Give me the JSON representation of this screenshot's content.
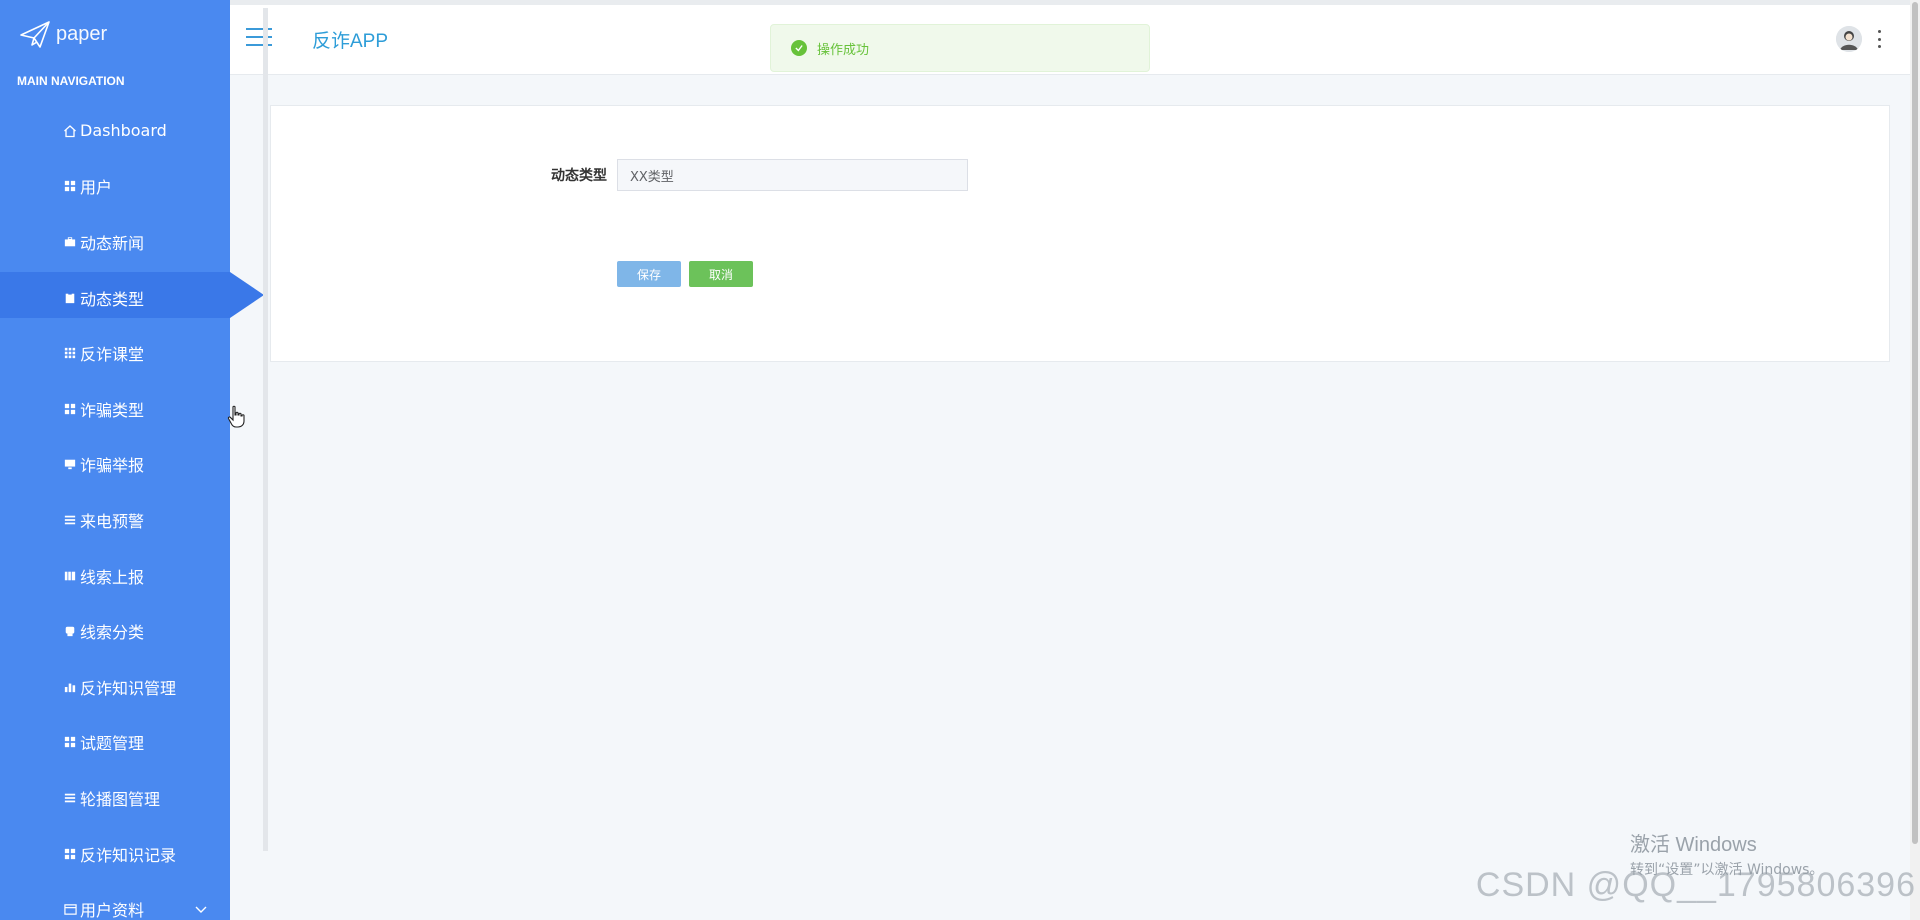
{
  "brand": {
    "name": "paper"
  },
  "sidebar": {
    "heading": "MAIN NAVIGATION",
    "items": [
      {
        "label": "Dashboard",
        "icon": "home-icon"
      },
      {
        "label": "用户",
        "icon": "grid-icon"
      },
      {
        "label": "动态新闻",
        "icon": "briefcase-icon"
      },
      {
        "label": "动态类型",
        "icon": "clipboard-icon",
        "active": true
      },
      {
        "label": "反诈课堂",
        "icon": "grid-icon"
      },
      {
        "label": "诈骗类型",
        "icon": "grid-icon"
      },
      {
        "label": "诈骗举报",
        "icon": "monitor-icon"
      },
      {
        "label": "来电预警",
        "icon": "list-icon"
      },
      {
        "label": "线索上报",
        "icon": "book-icon"
      },
      {
        "label": "线索分类",
        "icon": "folder-icon"
      },
      {
        "label": "反诈知识管理",
        "icon": "bar-chart-icon"
      },
      {
        "label": "试题管理",
        "icon": "grid-icon"
      },
      {
        "label": "轮播图管理",
        "icon": "list-icon"
      },
      {
        "label": "反诈知识记录",
        "icon": "grid-icon"
      },
      {
        "label": "用户资料",
        "icon": "calendar-icon"
      }
    ]
  },
  "header": {
    "title": "反诈APP"
  },
  "toast": {
    "message": "操作成功",
    "color": "#67c23a"
  },
  "form": {
    "label": "动态类型",
    "value": "XX类型",
    "save_label": "保存",
    "cancel_label": "取消"
  },
  "watermark": {
    "windows_title": "激活 Windows",
    "windows_sub": "转到“设置”以激活 Windows。",
    "csdn": "CSDN @QQ__1795806396"
  },
  "colors": {
    "sidebar": "#4a89f0",
    "sidebar_active": "#3a78e8",
    "accent": "#2e9dd8",
    "save": "#7fb6e8",
    "cancel": "#6cc25a"
  }
}
